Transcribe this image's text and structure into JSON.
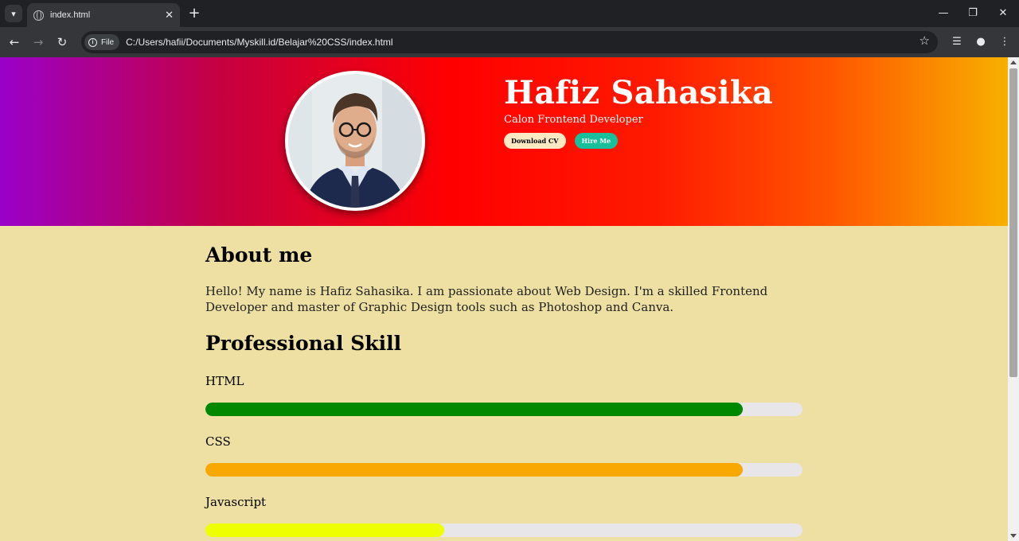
{
  "browser": {
    "tab_title": "index.html",
    "chip_label": "File",
    "url": "C:/Users/hafii/Documents/Myskill.id/Belajar%20CSS/index.html"
  },
  "hero": {
    "name": "Hafiz Sahasika",
    "role": "Calon Frontend Developer",
    "btn_download": "Download CV",
    "btn_hire": "Hire Me"
  },
  "about": {
    "heading": "About me",
    "text": "Hello! My name is Hafiz Sahasika. I am passionate about Web Design. I'm a skilled Frontend Developer and master of Graphic Design tools such as Photoshop and Canva."
  },
  "skills": {
    "heading": "Professional Skill",
    "items": [
      {
        "name": "HTML",
        "level": 0.9,
        "color": "#008800"
      },
      {
        "name": "CSS",
        "level": 0.9,
        "color": "#f8a800"
      },
      {
        "name": "Javascript",
        "level": 0.4,
        "color": "#eeff00"
      }
    ]
  },
  "colors": {
    "page_background": "#eee0a2",
    "hire_button": "#18bf9a",
    "download_button": "#fde8c4"
  },
  "icons": [
    "globe-icon",
    "close-icon",
    "plus-icon",
    "back-icon",
    "forward-icon",
    "reload-icon",
    "info-icon",
    "star-icon",
    "media-icon",
    "profile-icon",
    "menu-icon"
  ]
}
